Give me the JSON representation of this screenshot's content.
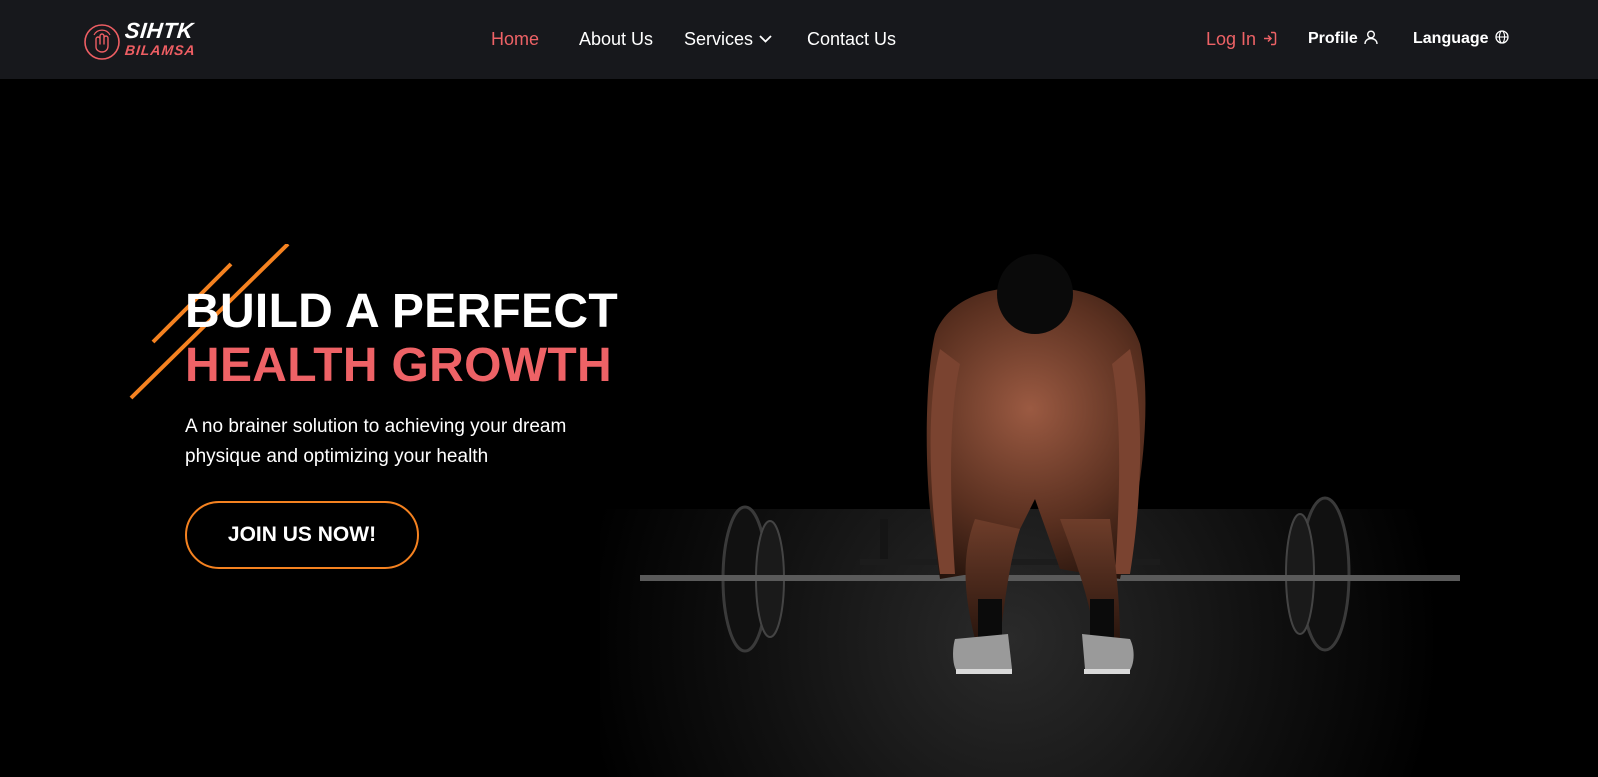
{
  "brand": {
    "line1": "SIHTK",
    "line2": "BILAMSA",
    "logo_icon": "fingerprint-hand-icon"
  },
  "nav": {
    "home": "Home",
    "about": "About Us",
    "services": "Services",
    "contact": "Contact Us",
    "login": "Log In",
    "profile": "Profile",
    "language": "Language"
  },
  "icons": {
    "services_dropdown": "chevron-down-icon",
    "login": "login-icon",
    "profile": "user-icon",
    "language": "globe-icon"
  },
  "hero": {
    "headline_line1": "BUILD A PERFECT",
    "headline_line2": "HEALTH GROWTH",
    "subtext": "A no brainer solution to achieving your dream physique and optimizing your health",
    "cta": "JOIN US NOW!"
  },
  "colors": {
    "accent": "#ee6266",
    "cta_border": "#f58220",
    "nav_bg": "#17181c",
    "hero_bg": "#000000"
  }
}
